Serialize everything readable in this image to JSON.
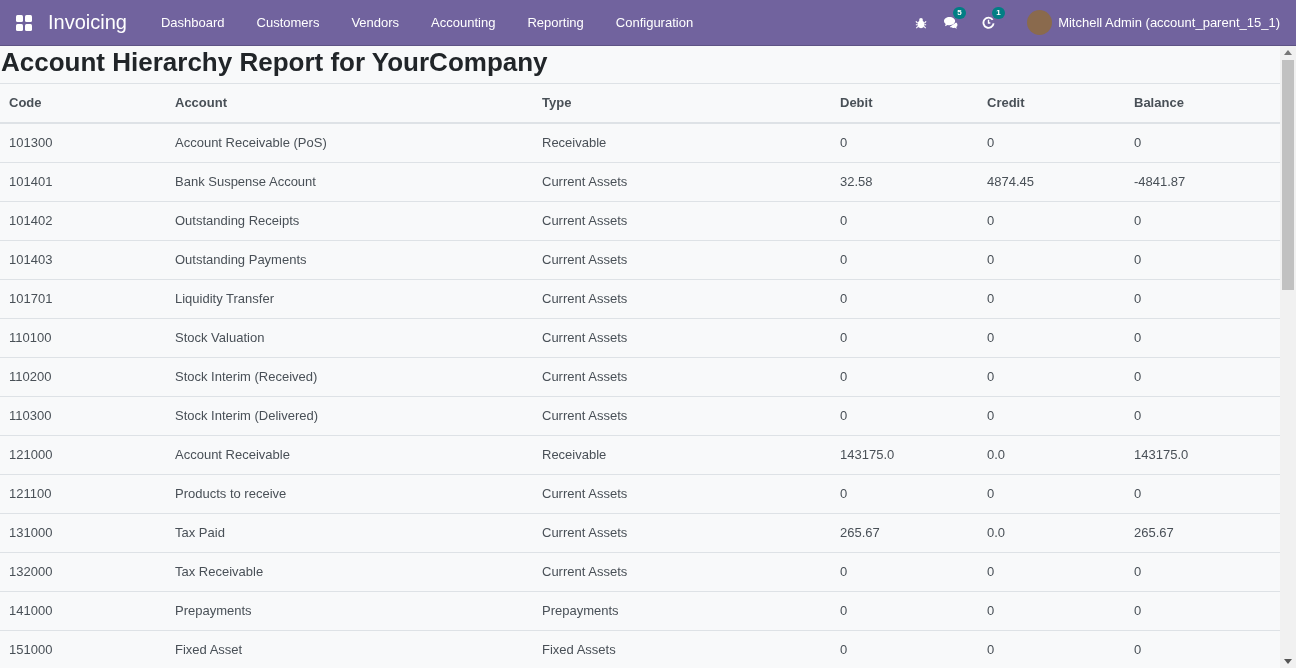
{
  "navbar": {
    "app_name": "Invoicing",
    "menu": [
      "Dashboard",
      "Customers",
      "Vendors",
      "Accounting",
      "Reporting",
      "Configuration"
    ],
    "messages_count": "5",
    "activities_count": "1",
    "user": "Mitchell Admin (account_parent_15_1)"
  },
  "title": "Account Hierarchy Report for YourCompany",
  "table": {
    "columns": [
      "Code",
      "Account",
      "Type",
      "Debit",
      "Credit",
      "Balance"
    ],
    "rows": [
      [
        "101300",
        "Account Receivable (PoS)",
        "Receivable",
        "0",
        "0",
        "0"
      ],
      [
        "101401",
        "Bank Suspense Account",
        "Current Assets",
        "32.58",
        "4874.45",
        "-4841.87"
      ],
      [
        "101402",
        "Outstanding Receipts",
        "Current Assets",
        "0",
        "0",
        "0"
      ],
      [
        "101403",
        "Outstanding Payments",
        "Current Assets",
        "0",
        "0",
        "0"
      ],
      [
        "101701",
        "Liquidity Transfer",
        "Current Assets",
        "0",
        "0",
        "0"
      ],
      [
        "110100",
        "Stock Valuation",
        "Current Assets",
        "0",
        "0",
        "0"
      ],
      [
        "110200",
        "Stock Interim (Received)",
        "Current Assets",
        "0",
        "0",
        "0"
      ],
      [
        "110300",
        "Stock Interim (Delivered)",
        "Current Assets",
        "0",
        "0",
        "0"
      ],
      [
        "121000",
        "Account Receivable",
        "Receivable",
        "143175.0",
        "0.0",
        "143175.0"
      ],
      [
        "121100",
        "Products to receive",
        "Current Assets",
        "0",
        "0",
        "0"
      ],
      [
        "131000",
        "Tax Paid",
        "Current Assets",
        "265.67",
        "0.0",
        "265.67"
      ],
      [
        "132000",
        "Tax Receivable",
        "Current Assets",
        "0",
        "0",
        "0"
      ],
      [
        "141000",
        "Prepayments",
        "Prepayments",
        "0",
        "0",
        "0"
      ],
      [
        "151000",
        "Fixed Asset",
        "Fixed Assets",
        "0",
        "0",
        "0"
      ]
    ]
  }
}
